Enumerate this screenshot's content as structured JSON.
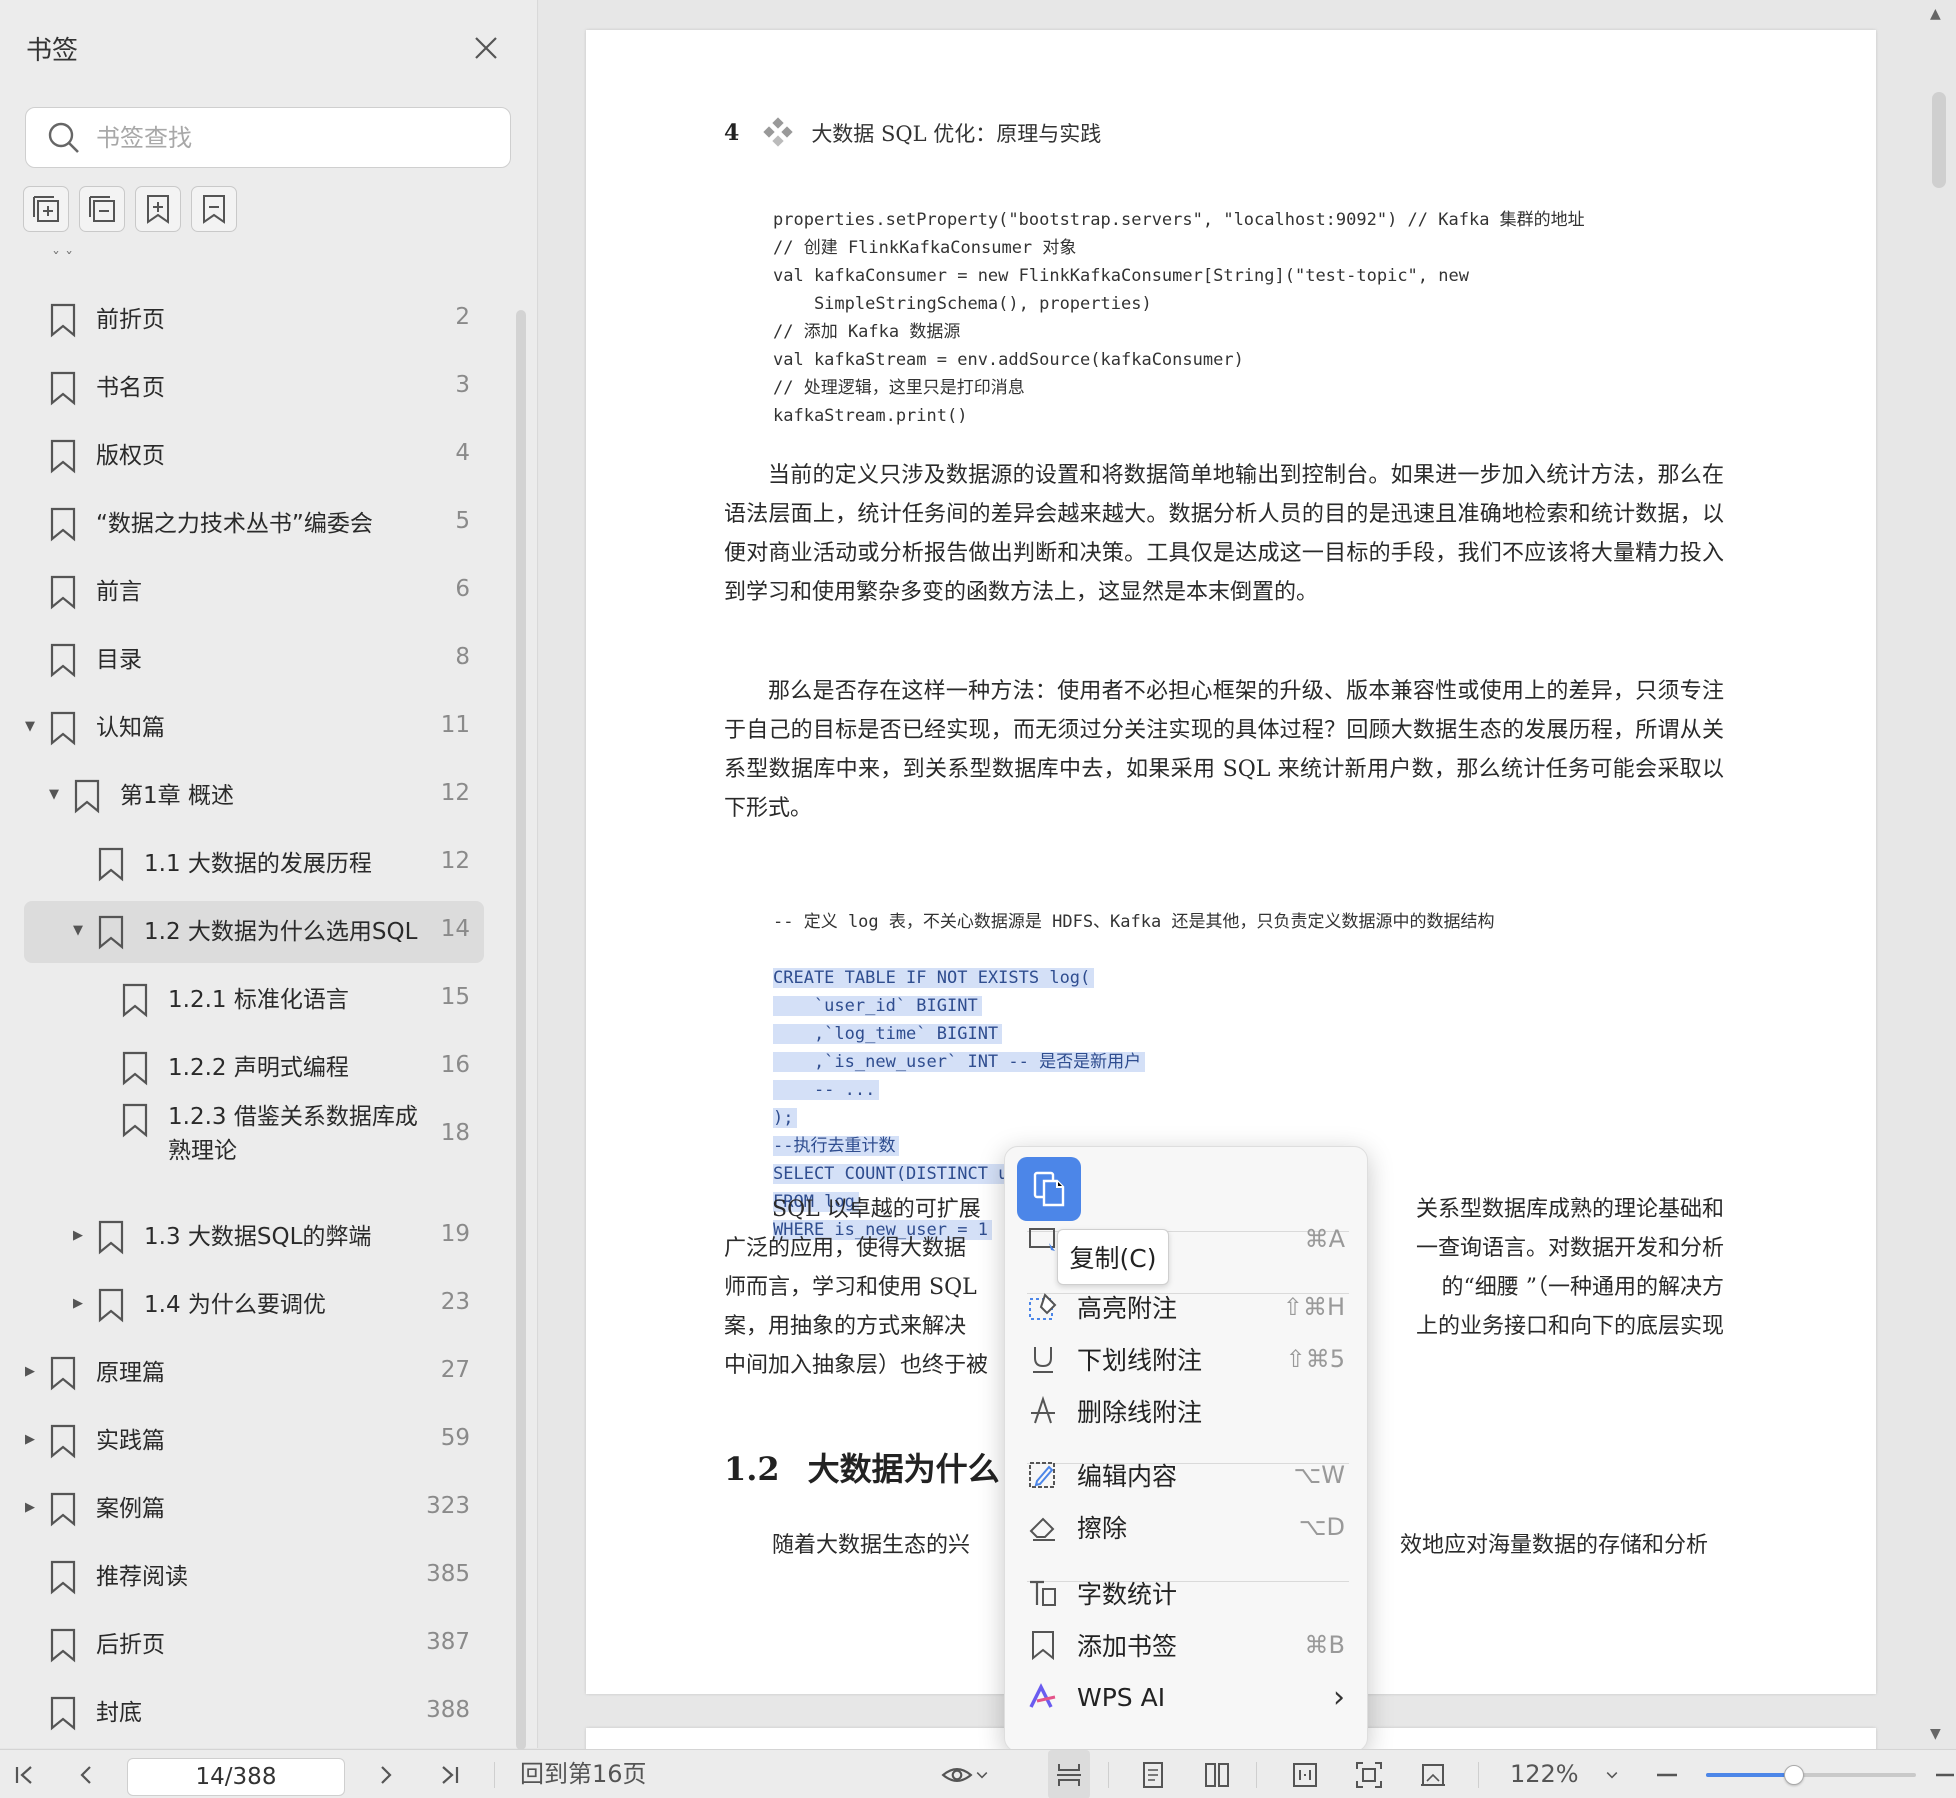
{
  "sidebar": {
    "title": "书签",
    "search_placeholder": "书签查找",
    "tools": [
      "expand-all-icon",
      "collapse-all-icon",
      "add-bookmark-icon",
      "remove-bookmark-icon"
    ],
    "items": [
      {
        "label": "前折页",
        "page": "2",
        "level": 0,
        "toggle": "none"
      },
      {
        "label": "书名页",
        "page": "3",
        "level": 0,
        "toggle": "none"
      },
      {
        "label": "版权页",
        "page": "4",
        "level": 0,
        "toggle": "none"
      },
      {
        "label": "“数据之力技术丛书”编委会",
        "page": "5",
        "level": 0,
        "toggle": "none"
      },
      {
        "label": "前言",
        "page": "6",
        "level": 0,
        "toggle": "none"
      },
      {
        "label": "目录",
        "page": "8",
        "level": 0,
        "toggle": "none"
      },
      {
        "label": "认知篇",
        "page": "11",
        "level": 0,
        "toggle": "expanded"
      },
      {
        "label": "第1章  概述",
        "page": "12",
        "level": 1,
        "toggle": "expanded"
      },
      {
        "label": "1.1 大数据的发展历程",
        "page": "12",
        "level": 2,
        "toggle": "none"
      },
      {
        "label": "1.2 大数据为什么选用SQL",
        "page": "14",
        "level": 2,
        "toggle": "expanded",
        "selected": true
      },
      {
        "label": "1.2.1 标准化语言",
        "page": "15",
        "level": 3,
        "toggle": "none"
      },
      {
        "label": "1.2.2 声明式编程",
        "page": "16",
        "level": 3,
        "toggle": "none"
      },
      {
        "label": "1.2.3 借鉴关系数据库成熟理论",
        "page": "18",
        "level": 3,
        "toggle": "none",
        "line1": "1.2.3 借鉴关系数据库成",
        "line2": "熟理论"
      },
      {
        "label": "1.3 大数据SQL的弊端",
        "page": "19",
        "level": 2,
        "toggle": "collapsed"
      },
      {
        "label": "1.4 为什么要调优",
        "page": "23",
        "level": 2,
        "toggle": "collapsed"
      },
      {
        "label": "原理篇",
        "page": "27",
        "level": 0,
        "toggle": "collapsed"
      },
      {
        "label": "实践篇",
        "page": "59",
        "level": 0,
        "toggle": "collapsed"
      },
      {
        "label": "案例篇",
        "page": "323",
        "level": 0,
        "toggle": "collapsed"
      },
      {
        "label": "推荐阅读",
        "page": "385",
        "level": 0,
        "toggle": "none"
      },
      {
        "label": "后折页",
        "page": "387",
        "level": 0,
        "toggle": "none"
      },
      {
        "label": "封底",
        "page": "388",
        "level": 0,
        "toggle": "none"
      }
    ]
  },
  "document": {
    "page_number": "4",
    "header_title": "大数据 SQL 优化：原理与实践",
    "code1": [
      "properties.setProperty(\"bootstrap.servers\", \"localhost:9092\") // Kafka 集群的地址",
      "// 创建 FlinkKafkaConsumer 对象",
      "val kafkaConsumer = new FlinkKafkaConsumer[String](\"test-topic\", new",
      "    SimpleStringSchema(), properties)",
      "// 添加 Kafka 数据源",
      "val kafkaStream = env.addSource(kafkaConsumer)",
      "// 处理逻辑，这里只是打印消息",
      "kafkaStream.print()"
    ],
    "para1": "当前的定义只涉及数据源的设置和将数据简单地输出到控制台。如果进一步加入统计方法，那么在语法层面上，统计任务间的差异会越来越大。数据分析人员的目的是迅速且准确地检索和统计数据，以便对商业活动或分析报告做出判断和决策。工具仅是达成这一目标的手段，我们不应该将大量精力投入到学习和使用繁杂多变的函数方法上，这显然是本末倒置的。",
    "para2": "那么是否存在这样一种方法：使用者不必担心框架的升级、版本兼容性或使用上的差异，只须专注于自己的目标是否已经实现，而无须过分关注实现的具体过程？回顾大数据生态的发展历程，所谓从关系型数据库中来，到关系型数据库中去，如果采用 SQL 来统计新用户数，那么统计任务可能会采取以下形式。",
    "code2_comment": "-- 定义 log 表，不关心数据源是 HDFS、Kafka 还是其他，只负责定义数据源中的数据结构",
    "code2": [
      "CREATE TABLE IF NOT EXISTS log(",
      "    `user_id` BIGINT",
      "    ,`log_time` BIGINT",
      "    ,`is_new_user` INT -- 是否是新用户",
      "    -- ...",
      ");",
      "--执行去重计数",
      "SELECT COUNT(DISTINCT user_id)",
      "FROM log",
      "WHERE is_new_user = 1"
    ],
    "para3_lines": [
      {
        "left": "SQL 以卓越的可扩展",
        "right": "关系型数据库成熟的理论基础和"
      },
      {
        "left": "广泛的应用，使得大数据",
        "right": "一查询语言。对数据开发和分析"
      },
      {
        "left": "师而言，学习和使用 SQL",
        "right": "的“细腰 ”（一种通用的解决方"
      },
      {
        "left": "案，用抽象的方式来解决",
        "right": "上的业务接口和向下的底层实现"
      },
      {
        "left": "中间加入抽象层）也终于被",
        "right": ""
      }
    ],
    "heading_num": "1.2",
    "heading_text": "大数据为什么",
    "para4_left": "随着大数据生态的兴",
    "para4_right": "效地应对海量数据的存储和分析"
  },
  "context_menu": {
    "tooltip": "复制(C)",
    "items": [
      {
        "label": "",
        "shortcut": "⌘A",
        "icon": "select-all-icon"
      },
      {
        "label": "高亮附注",
        "shortcut": "⇧⌘H",
        "icon": "highlight-icon"
      },
      {
        "label": "下划线附注",
        "shortcut": "⇧⌘5",
        "icon": "underline-icon"
      },
      {
        "label": "删除线附注",
        "shortcut": "",
        "icon": "strikethrough-icon"
      },
      {
        "label": "编辑内容",
        "shortcut": "⌥W",
        "icon": "edit-icon"
      },
      {
        "label": "擦除",
        "shortcut": "⌥D",
        "icon": "eraser-icon"
      },
      {
        "label": "字数统计",
        "shortcut": "",
        "icon": "word-count-icon"
      },
      {
        "label": "添加书签",
        "shortcut": "⌘B",
        "icon": "bookmark-icon"
      },
      {
        "label": "WPS AI",
        "shortcut": "›",
        "icon": "wps-ai-icon"
      }
    ]
  },
  "bottom_bar": {
    "page_input": "14/388",
    "goto_label": "回到第16页",
    "zoom": "122%",
    "zoom_slider_fraction": 0.42
  },
  "colors": {
    "accent": "#4c86e8",
    "selection": "#d4e0f7"
  }
}
